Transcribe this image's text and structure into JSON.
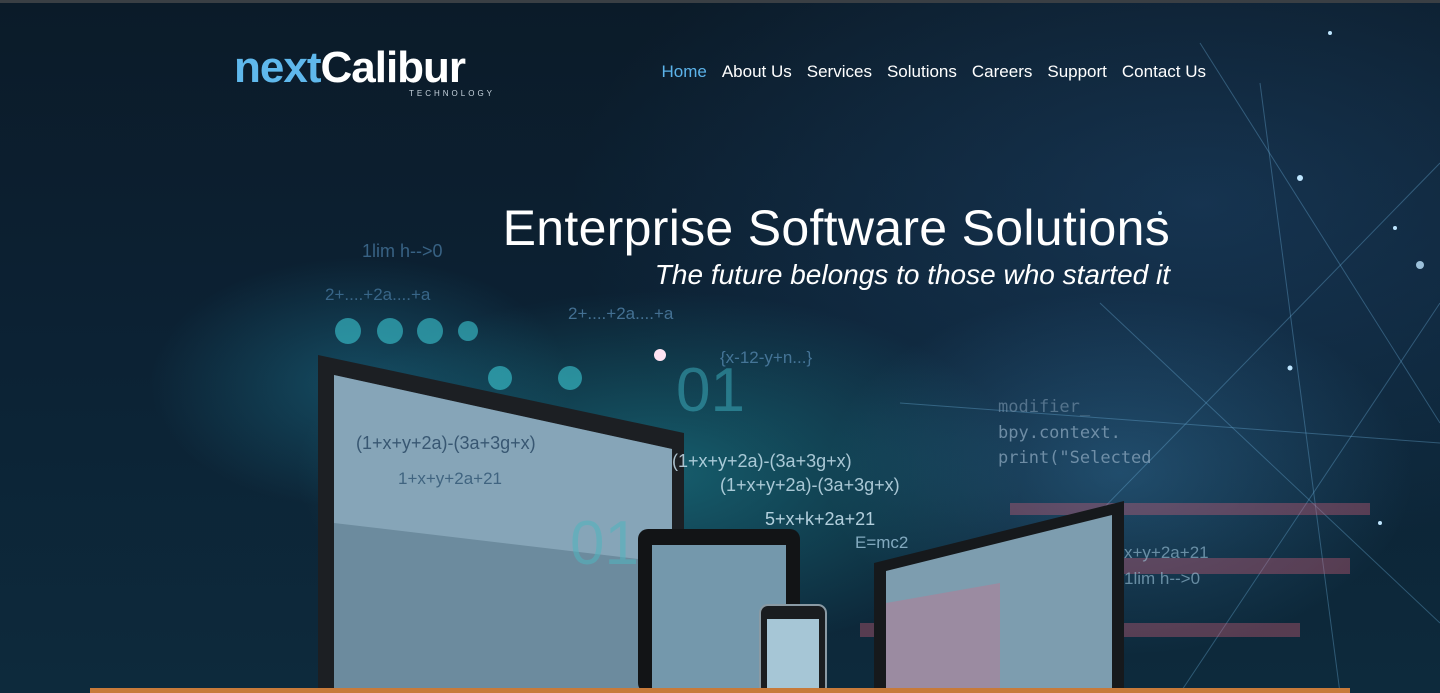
{
  "brand": {
    "logo_part1": "next",
    "logo_part2": "Calibur",
    "logo_sub": "TECHNOLOGY"
  },
  "nav": {
    "items": [
      {
        "label": "Home",
        "active": true
      },
      {
        "label": "About Us"
      },
      {
        "label": "Services"
      },
      {
        "label": "Solutions"
      },
      {
        "label": "Careers"
      },
      {
        "label": "Support"
      },
      {
        "label": "Contact Us"
      }
    ]
  },
  "hero": {
    "title": "Enterprise Software Solutions",
    "tagline": "The future belongs to those who started it",
    "overlay_text": [
      "1lim h-->0",
      "2+....+2a....+a",
      "2+....+2a....+a",
      "(1+x+y+2a)-(3a+3g+x)",
      "1+x+y+2a+21",
      "(1+x+y+2a)-(3a+3g+x)",
      "(1+x+y+2a)-(3a+3g+x)",
      "5+x+k+2a+21",
      "E=mc2",
      "{x-12-y+n...}",
      "01",
      "01",
      "modifier_",
      "bpy.context.",
      "print(\"Selected",
      "x+y+2a+21",
      "1lim h-->0"
    ]
  },
  "colors": {
    "accent": "#5cb3ea",
    "background": "#0b1c2b",
    "text": "#ffffff"
  }
}
